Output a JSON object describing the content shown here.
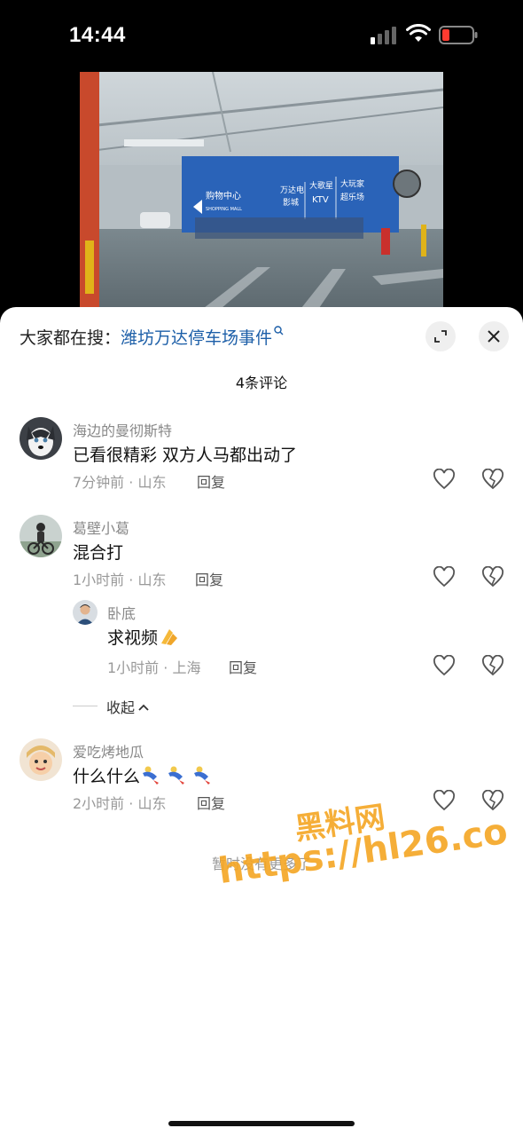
{
  "status_bar": {
    "time": "14:44"
  },
  "video": {
    "signs": [
      "购物中心",
      "SHOPPING MALL",
      "万达电",
      "影城",
      "大歌星",
      "KTV",
      "大玩家",
      "超乐场"
    ]
  },
  "search": {
    "prefix": "大家都在搜：",
    "term": "潍坊万达停车场事件"
  },
  "comments_header": {
    "count_label": "4条评论"
  },
  "comments": [
    {
      "username": "海边的曼彻斯特",
      "text": "已看很精彩 双方人马都出动了",
      "meta": "7分钟前 · 山东",
      "reply_label": "回复"
    },
    {
      "username": "葛壁小葛",
      "text": "混合打",
      "meta": "1小时前 · 山东",
      "reply_label": "回复"
    },
    {
      "username": "卧底",
      "text": "求视频",
      "meta": "1小时前 · 上海",
      "reply_label": "回复"
    },
    {
      "username": "爱吃烤地瓜",
      "text": "什么什么",
      "meta": "2小时前 · 山东",
      "reply_label": "回复"
    }
  ],
  "collapse_label": "收起",
  "no_more_label": "暂时没有更多了",
  "watermark": {
    "title": "黑料网",
    "url": "https://hl26.co"
  },
  "colors": {
    "link": "#1d5fa8",
    "watermark": "#f5a623",
    "sign_blue": "#2a63b8"
  }
}
